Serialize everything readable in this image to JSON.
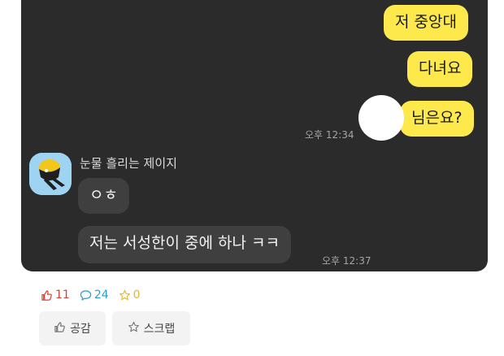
{
  "chat": {
    "my_messages": [
      "저 중앙대",
      "다녀요",
      "님은요?"
    ],
    "my_time": "오후 12:34",
    "sender_name": "눈물 흘리는 제이지",
    "their_messages": [
      "ㅇㅎ",
      "저는 서성한이 중에 하나 ㅋㅋ"
    ],
    "their_time": "오후 12:37"
  },
  "reactions": {
    "likes": "11",
    "comments": "24",
    "stars": "0"
  },
  "actions": {
    "empathy_label": "공감",
    "scrap_label": "스크랩"
  },
  "colors": {
    "chat_bg": "#2b2b2b",
    "my_bubble": "#fde94c",
    "their_bubble": "#3f3f3f",
    "like": "#d0453b",
    "comment": "#2aa0c8",
    "star": "#e2b72a"
  }
}
